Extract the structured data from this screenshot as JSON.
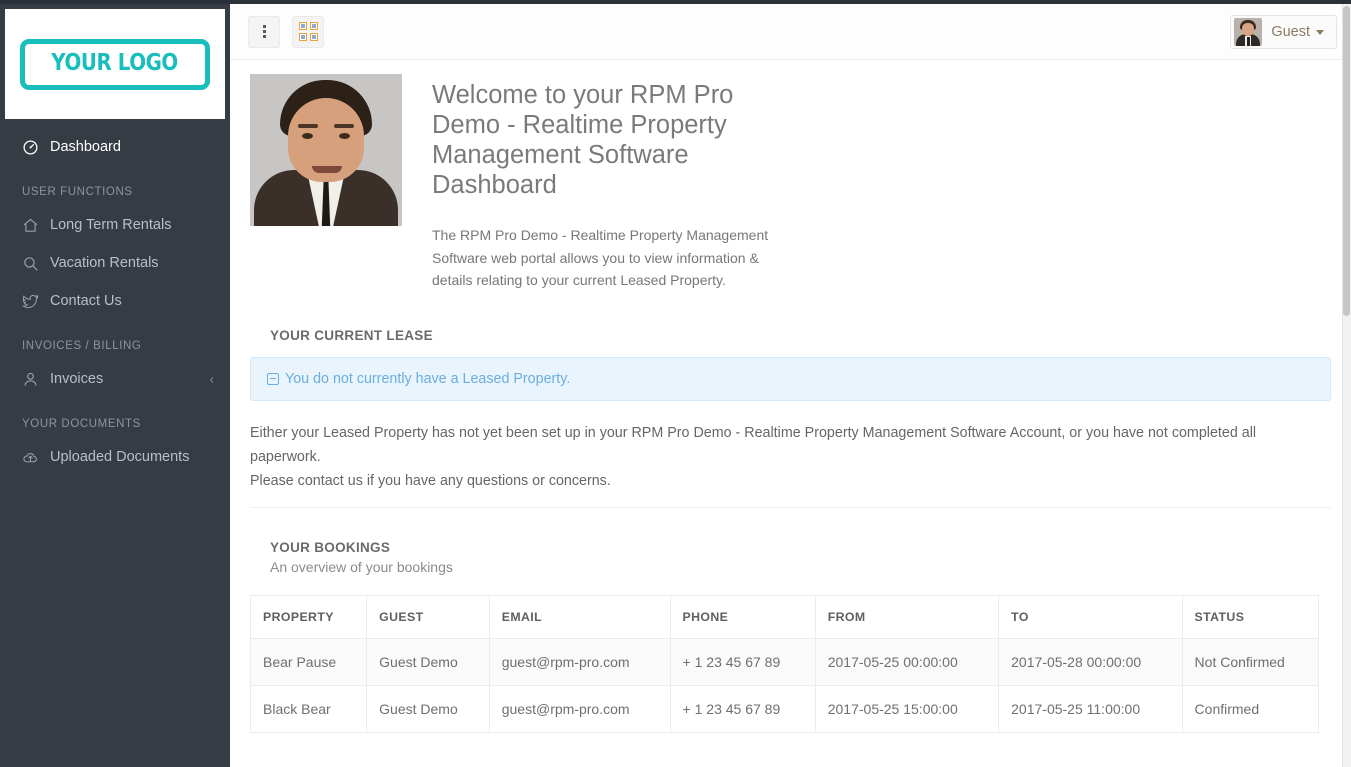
{
  "sidebar": {
    "logo": {
      "text": "YOUR LOGO",
      "color": "#17bebb"
    },
    "primary": [
      {
        "label": "Dashboard",
        "icon": "dashboard-icon",
        "active": true
      }
    ],
    "sections": [
      {
        "title": "USER FUNCTIONS",
        "items": [
          {
            "label": "Long Term Rentals",
            "icon": "home-icon"
          },
          {
            "label": "Vacation Rentals",
            "icon": "search-icon"
          },
          {
            "label": "Contact Us",
            "icon": "twitter-bird-icon"
          }
        ]
      },
      {
        "title": "INVOICES / BILLING",
        "items": [
          {
            "label": "Invoices",
            "icon": "user-icon",
            "chevron": "‹"
          }
        ]
      },
      {
        "title": "YOUR DOCUMENTS",
        "items": [
          {
            "label": "Uploaded Documents",
            "icon": "cloud-upload-icon"
          }
        ]
      }
    ]
  },
  "topbar": {
    "menu_toggle_icon": "vertical-dots-icon",
    "grid_toggle_icon": "grid-apps-icon",
    "user": {
      "name": "Guest",
      "caret": "▾",
      "avatar_icon": "user-avatar-photo"
    }
  },
  "welcome": {
    "photo_icon": "agent-portrait-photo",
    "title": "Welcome to your RPM Pro Demo - Realtime Property Management Software Dashboard",
    "description": "The RPM Pro Demo - Realtime Property Management Software web portal allows you to view information & details relating to your current Leased Property."
  },
  "lease": {
    "section_title": "YOUR CURRENT LEASE",
    "alert": {
      "icon": "minus-square-icon",
      "text": "You do not currently have a Leased Property.",
      "bg_color": "#e9f4fd",
      "text_color": "#6aaee0"
    },
    "paragraph_line1": "Either your Leased Property has not yet been set up in your RPM Pro Demo - Realtime Property Management Software Account, or you have not completed all paperwork.",
    "paragraph_line2": "Please contact us if you have any questions or concerns."
  },
  "bookings": {
    "section_title": "YOUR BOOKINGS",
    "section_subtitle": "An overview of your bookings",
    "columns": [
      "PROPERTY",
      "GUEST",
      "EMAIL",
      "PHONE",
      "FROM",
      "TO",
      "STATUS"
    ],
    "rows": [
      {
        "property": "Bear Pause",
        "guest": "Guest Demo",
        "email": "guest@rpm-pro.com",
        "phone": "+ 1 23 45 67 89",
        "from": "2017-05-25 00:00:00",
        "to": "2017-05-28 00:00:00",
        "status": "Not Confirmed"
      },
      {
        "property": "Black Bear",
        "guest": "Guest Demo",
        "email": "guest@rpm-pro.com",
        "phone": "+ 1 23 45 67 89",
        "from": "2017-05-25 15:00:00",
        "to": "2017-05-25 11:00:00",
        "status": "Confirmed"
      }
    ]
  }
}
